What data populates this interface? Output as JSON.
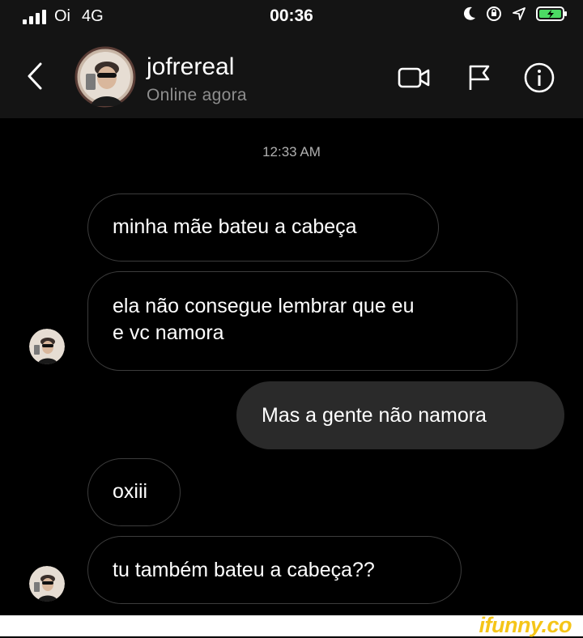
{
  "status_bar": {
    "carrier": "Oi",
    "network": "4G",
    "time": "00:36"
  },
  "header": {
    "name": "jofrereal",
    "status": "Online agora"
  },
  "conversation": {
    "timestamp": "12:33 AM",
    "messages": [
      {
        "from": "them",
        "lines": [
          "minha mãe bateu a cabeça"
        ]
      },
      {
        "from": "them",
        "lines": [
          "ela não consegue lembrar que eu",
          "e vc namora"
        ]
      },
      {
        "from": "me",
        "lines": [
          "Mas a gente não namora"
        ]
      },
      {
        "from": "them",
        "lines": [
          "oxiii"
        ]
      },
      {
        "from": "them",
        "lines": [
          "tu também bateu a cabeça??"
        ]
      }
    ]
  },
  "watermark": "ifunny.co",
  "colors": {
    "background": "#000000",
    "header": "#141414",
    "incoming_border": "#3c3c3c",
    "outgoing_bubble": "#2a2a2a",
    "watermark": "#f5c518"
  },
  "icons": [
    "signal-bars-icon",
    "moon-icon",
    "orientation-lock-icon",
    "location-arrow-icon",
    "battery-icon",
    "back-chevron-icon",
    "video-camera-icon",
    "flag-icon",
    "info-icon"
  ]
}
